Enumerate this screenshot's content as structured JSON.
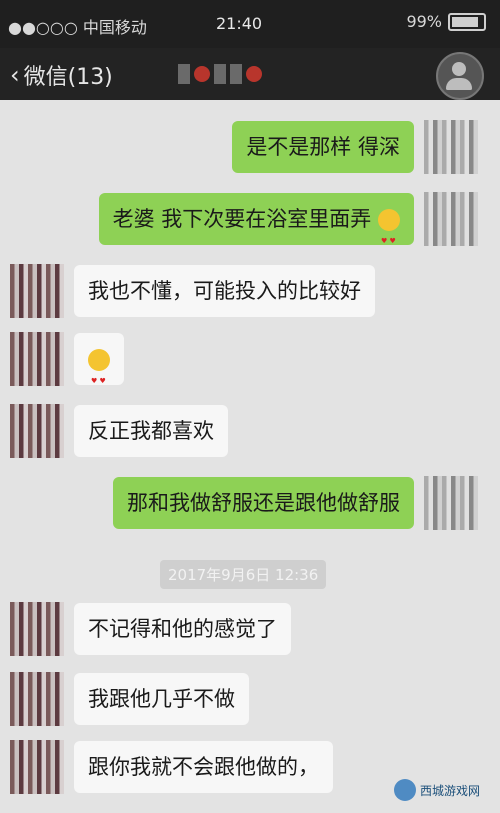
{
  "status": {
    "carrier": "●●○○○ 中国移动",
    "time": "21:40",
    "battery": "99%"
  },
  "nav": {
    "back_label": "微信(13)"
  },
  "messages": [
    {
      "side": "out",
      "text": "是不是那样  得深"
    },
    {
      "side": "out",
      "text": "老婆 我下次要在浴室里面弄",
      "emoji": "heart-eyes-emoji"
    },
    {
      "side": "in",
      "text": "我也不懂，可能投入的比较好"
    },
    {
      "side": "in",
      "text": "",
      "emoji": "heart-eyes-emoji"
    },
    {
      "side": "in",
      "text": "反正我都喜欢"
    },
    {
      "side": "out",
      "text": "那和我做舒服还是跟他做舒服"
    },
    {
      "side": "in",
      "text": "不记得和他的感觉了"
    },
    {
      "side": "in",
      "text": "我跟他几乎不做"
    },
    {
      "side": "in",
      "text": "跟你我就不会跟他做的，"
    }
  ],
  "timestamp": "2017年9月6日 12:36",
  "watermark": "西城游戏网"
}
